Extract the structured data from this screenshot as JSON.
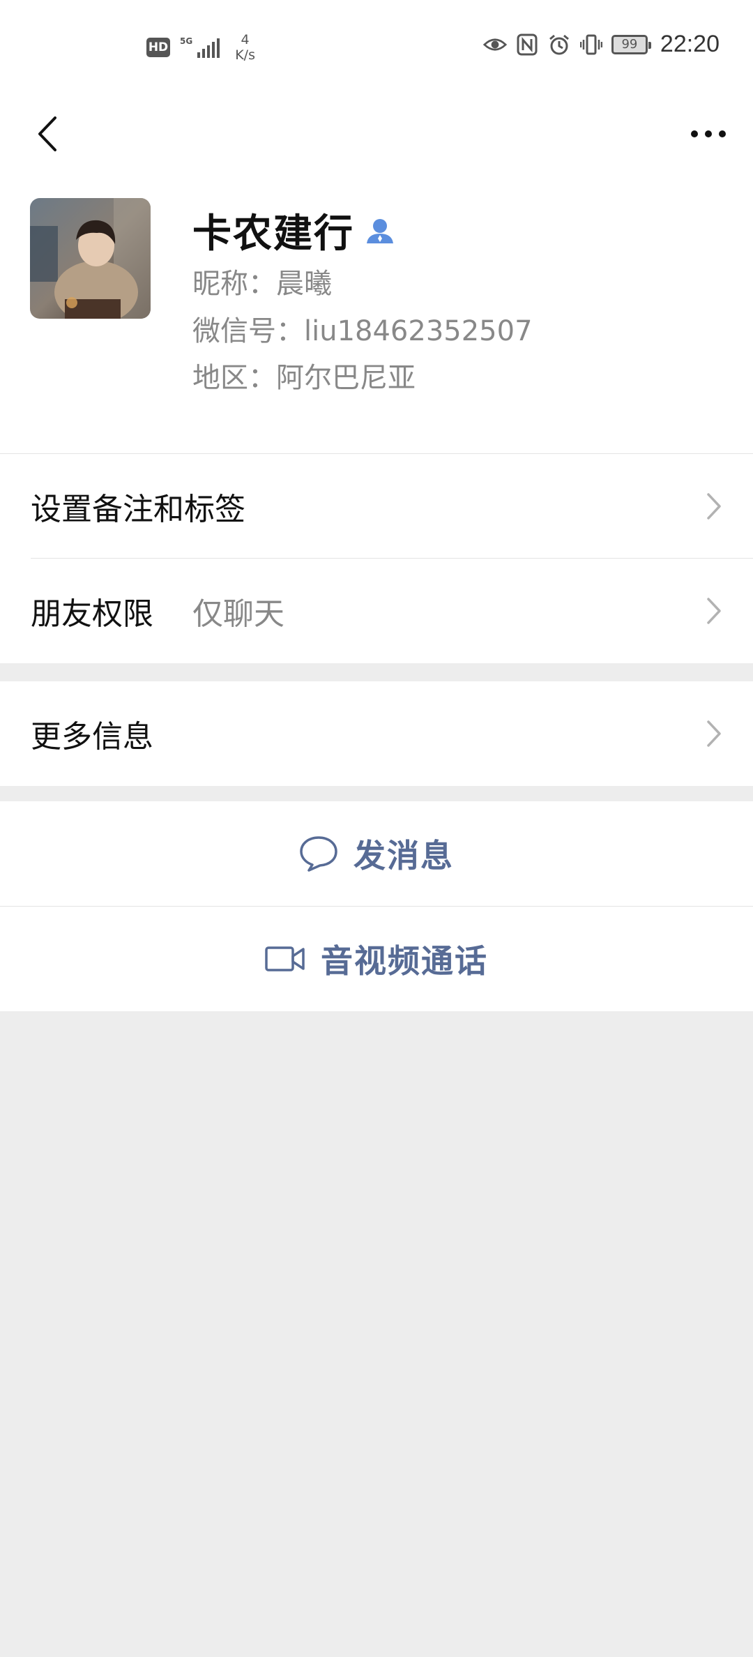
{
  "status_bar": {
    "network_hd": "HD",
    "network_type": "5G",
    "speed_value": "4",
    "speed_unit": "K/s",
    "battery": "99",
    "time": "22:20"
  },
  "profile": {
    "remark_name": "卡农建行",
    "nickname": "昵称：晨曦",
    "wechat_id": "微信号：liu18462352507",
    "region": "地区：阿尔巴尼亚"
  },
  "settings": {
    "remark_tags_label": "设置备注和标签",
    "friend_permission_label": "朋友权限",
    "friend_permission_value": "仅聊天",
    "more_info_label": "更多信息"
  },
  "actions": {
    "send_message": "发消息",
    "av_call": "音视频通话"
  },
  "colors": {
    "link_blue": "#576b95",
    "page_bg": "#ededed",
    "contact_icon": "#5b8ede"
  }
}
